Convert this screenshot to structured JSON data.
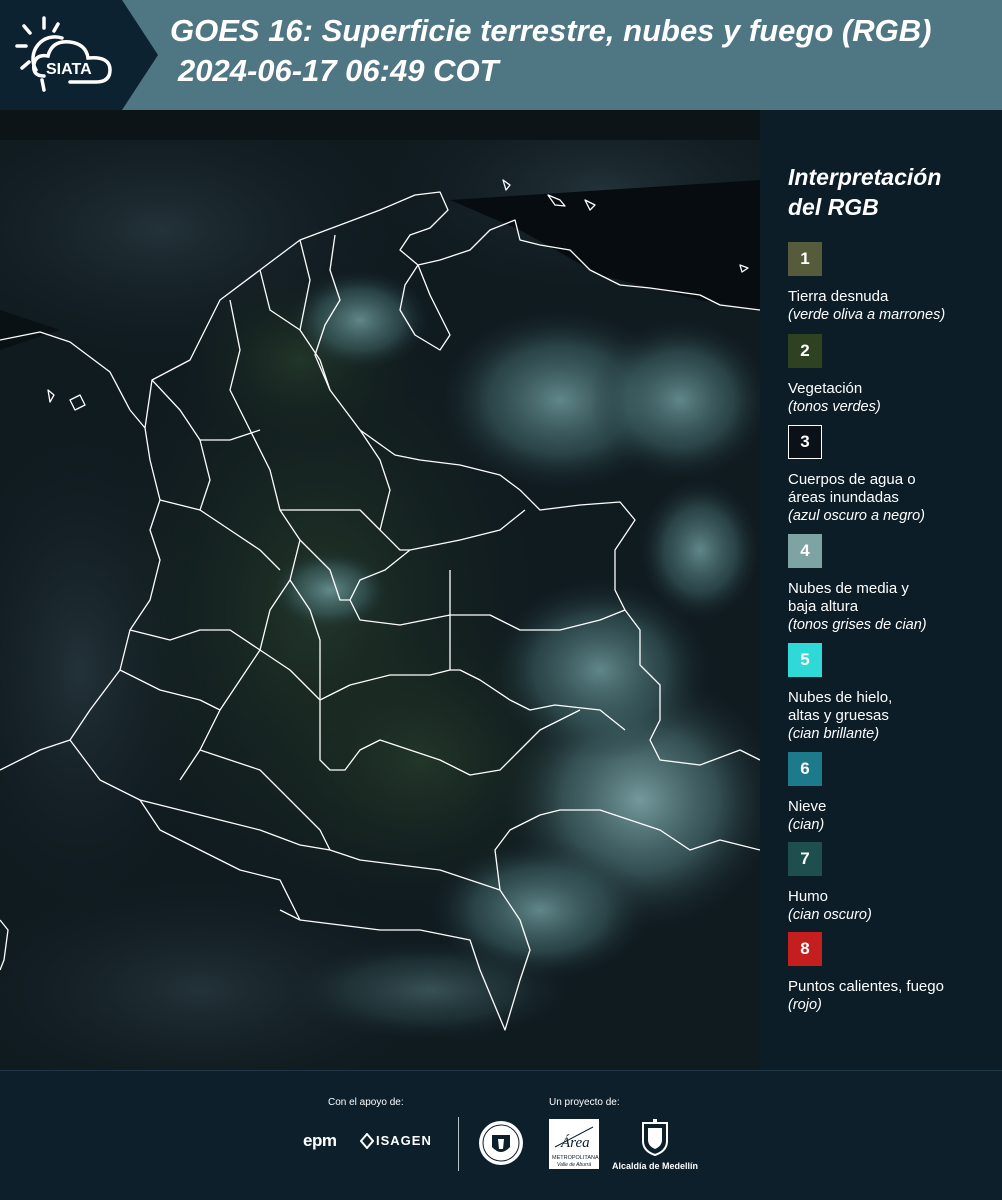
{
  "header": {
    "brand": "SIATA",
    "title": "GOES 16: Superficie terrestre, nubes y fuego (RGB)",
    "datetime": "2024-06-17 06:49 COT"
  },
  "legend": {
    "title_line1": "Interpretación",
    "title_line2": "del RGB",
    "items": [
      {
        "number": "1",
        "color": "#565b3b",
        "label": "Tierra desnuda",
        "sub": "(verde oliva a marrones)"
      },
      {
        "number": "2",
        "color": "#2e4221",
        "label": "Vegetación",
        "sub": "(tonos verdes)"
      },
      {
        "number": "3",
        "color": "#0b1118",
        "label": "Cuerpos de agua o",
        "label2": "áreas inundadas",
        "sub": "(azul oscuro a negro)"
      },
      {
        "number": "4",
        "color": "#7ea3a3",
        "label": "Nubes de media y",
        "label2": "baja altura",
        "sub": "(tonos grises de cian)"
      },
      {
        "number": "5",
        "color": "#2fd9d7",
        "label": "Nubes de hielo,",
        "label2": "altas y gruesas",
        "sub": "(cian brillante)"
      },
      {
        "number": "6",
        "color": "#1c7a8a",
        "label": "Nieve",
        "sub": "(cian)"
      },
      {
        "number": "7",
        "color": "#1f4e4f",
        "label": "Humo",
        "sub": "(cian oscuro)"
      },
      {
        "number": "8",
        "color": "#c41e1e",
        "label": "Puntos calientes, fuego",
        "sub": "(rojo)"
      }
    ]
  },
  "footer": {
    "support_label": "Con el apoyo de:",
    "project_label": "Un proyecto de:",
    "epm": "epm",
    "isagen": "ISAGEN",
    "amva_line1": "Área",
    "amva_line2": "METROPOLITANA",
    "amva_line3": "Valle de Aburrá",
    "alcaldia": "Alcaldía de Medellín"
  }
}
